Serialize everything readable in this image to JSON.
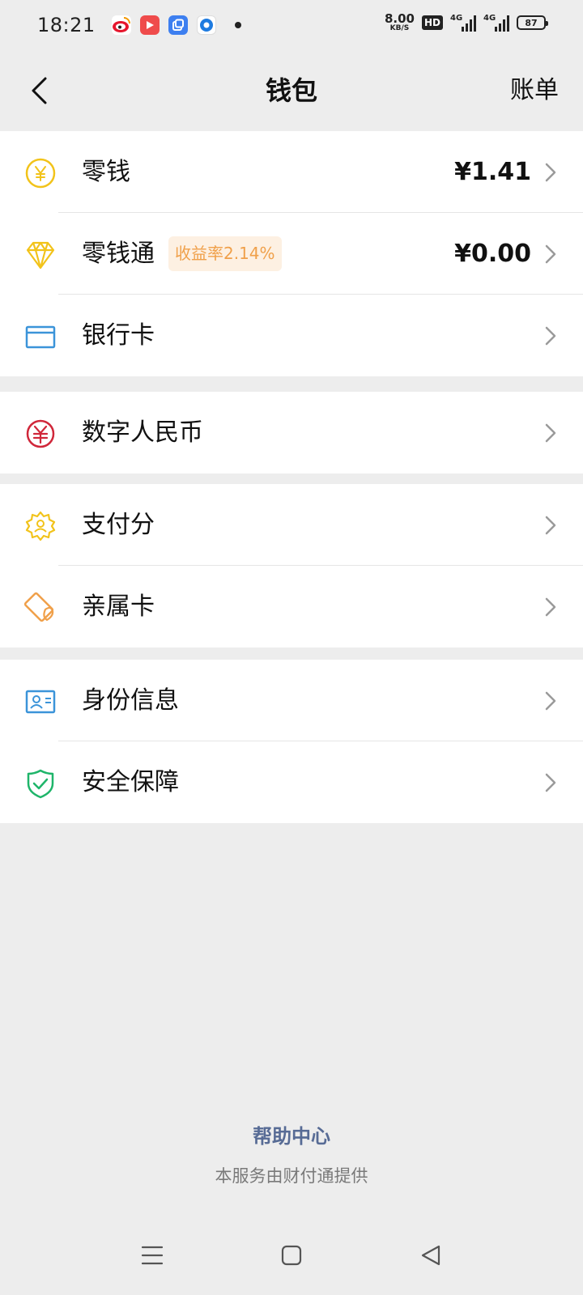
{
  "status_bar": {
    "time": "18:21",
    "apps": [
      "weibo-icon",
      "video-app-icon",
      "multiwindow-app-icon",
      "browser-app-icon"
    ],
    "net_speed_value": "8.00",
    "net_speed_unit": "KB/S",
    "hd_label": "HD",
    "net_type_1": "4G",
    "net_type_2": "4G",
    "battery": "87"
  },
  "header": {
    "title": "钱包",
    "right_link": "账单"
  },
  "groups": [
    {
      "items": [
        {
          "label": "零钱",
          "value": "¥1.41",
          "icon": "yuan-coin-icon",
          "color": "#f2c31a"
        },
        {
          "label": "零钱通",
          "value": "¥0.00",
          "badge": "收益率2.14%",
          "icon": "diamond-icon",
          "color": "#f2c31a"
        },
        {
          "label": "银行卡",
          "icon": "bank-card-icon",
          "color": "#3b94d9"
        }
      ]
    },
    {
      "items": [
        {
          "label": "数字人民币",
          "icon": "digital-rmb-icon",
          "color": "#d0273a"
        }
      ]
    },
    {
      "items": [
        {
          "label": "支付分",
          "icon": "pay-score-icon",
          "color": "#f2c31a"
        },
        {
          "label": "亲属卡",
          "icon": "family-card-icon",
          "color": "#f0a04a"
        }
      ]
    },
    {
      "items": [
        {
          "label": "身份信息",
          "icon": "id-card-icon",
          "color": "#3b94d9"
        },
        {
          "label": "安全保障",
          "icon": "shield-check-icon",
          "color": "#1fb56a"
        }
      ]
    }
  ],
  "footer": {
    "help_link": "帮助中心",
    "provider": "本服务由财付通提供"
  }
}
